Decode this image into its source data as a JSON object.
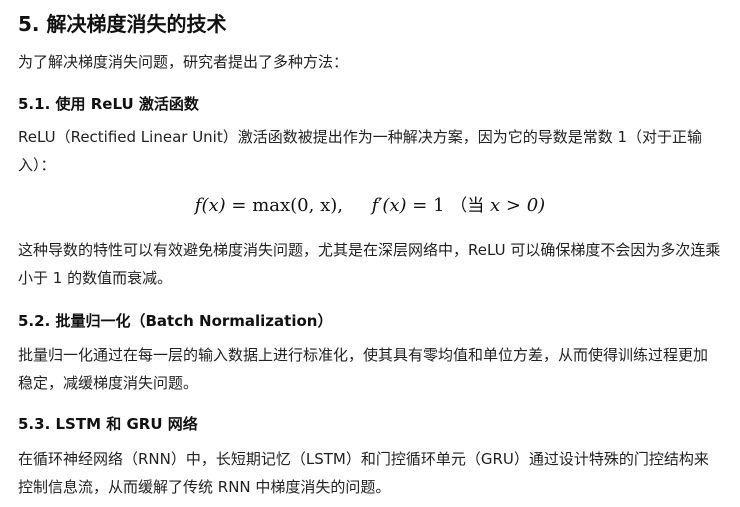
{
  "section": {
    "title": "5. 解决梯度消失的技术",
    "intro": "为了解决梯度消失问题，研究者提出了多种方法："
  },
  "subsections": [
    {
      "title": "5.1. 使用 ReLU 激活函数",
      "para1": "ReLU（Rectified Linear Unit）激活函数被提出作为一种解决方案，因为它的导数是常数 1（对于正输入）：",
      "formula": {
        "f_lhs": "f(x)",
        "f_rhs": "max(0, x),",
        "d_lhs": "f′(x)",
        "d_rhs": "1",
        "cond_text": "（当",
        "cond_expr": "x > 0)"
      },
      "para2": "这种导数的特性可以有效避免梯度消失问题，尤其是在深层网络中，ReLU 可以确保梯度不会因为多次连乘小于 1 的数值而衰减。"
    },
    {
      "title": "5.2. 批量归一化（Batch Normalization）",
      "para1": "批量归一化通过在每一层的输入数据上进行标准化，使其具有零均值和单位方差，从而使得训练过程更加稳定，减缓梯度消失问题。"
    },
    {
      "title": "5.3. LSTM 和 GRU 网络",
      "para1": "在循环神经网络（RNN）中，长短期记忆（LSTM）和门控循环单元（GRU）通过设计特殊的门控结构来控制信息流，从而缓解了传统 RNN 中梯度消失的问题。"
    }
  ]
}
